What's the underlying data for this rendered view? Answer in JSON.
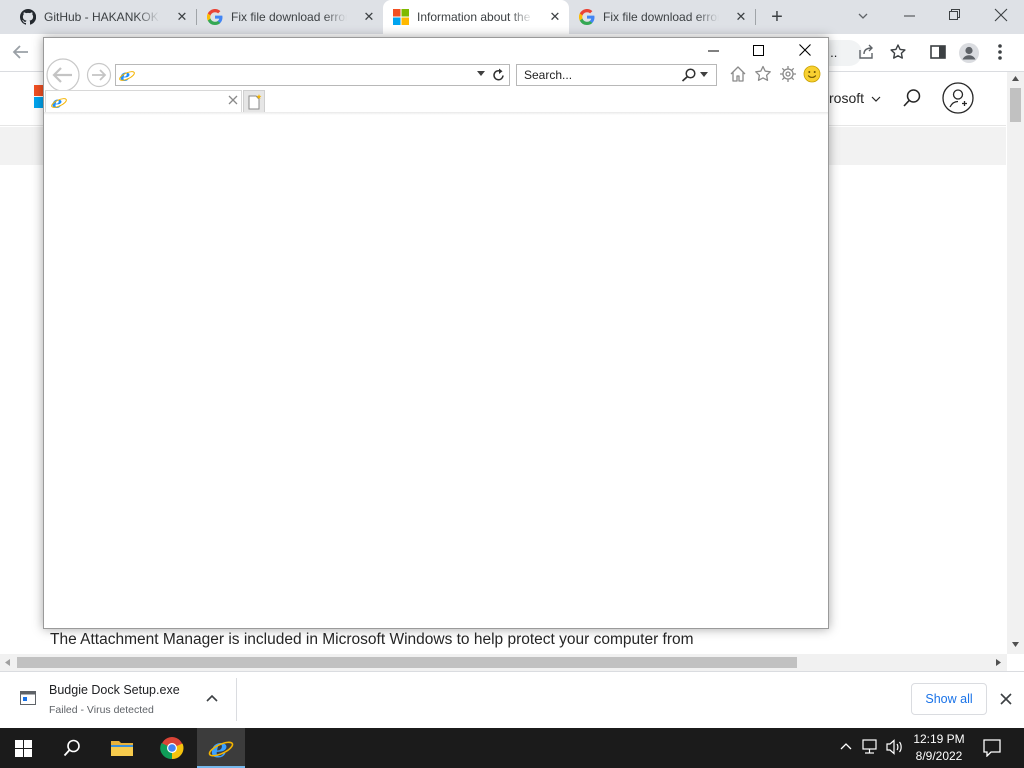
{
  "chrome": {
    "tabs": [
      {
        "title": "GitHub - HAKANKOKCU/Budgie",
        "favicon": "github-icon",
        "active": false
      },
      {
        "title": "Fix file download errors",
        "favicon": "google-icon",
        "active": false
      },
      {
        "title": "Information about the Attachment Manager",
        "favicon": "microsoft-icon",
        "active": true
      },
      {
        "title": "Fix file download errors",
        "favicon": "google-icon",
        "active": false
      }
    ],
    "omnibox_text": "c...",
    "new_tab_label": "+"
  },
  "page": {
    "header_nav_text": "rosoft",
    "body_text": "The Attachment Manager is included in Microsoft Windows to help protect your computer from"
  },
  "ie": {
    "search_placeholder": "Search...",
    "tab_title": ""
  },
  "downloads": {
    "file_name": "Budgie Dock Setup.exe",
    "status": "Failed - Virus detected",
    "show_all_label": "Show all"
  },
  "taskbar": {
    "time": "12:19 PM",
    "date": "8/9/2022"
  },
  "colors": {
    "chrome_tabstrip": "#dee1e6",
    "taskbar": "#1b1b1b",
    "ie_blue": "#1e90ff",
    "accent_link": "#1a73e8"
  }
}
